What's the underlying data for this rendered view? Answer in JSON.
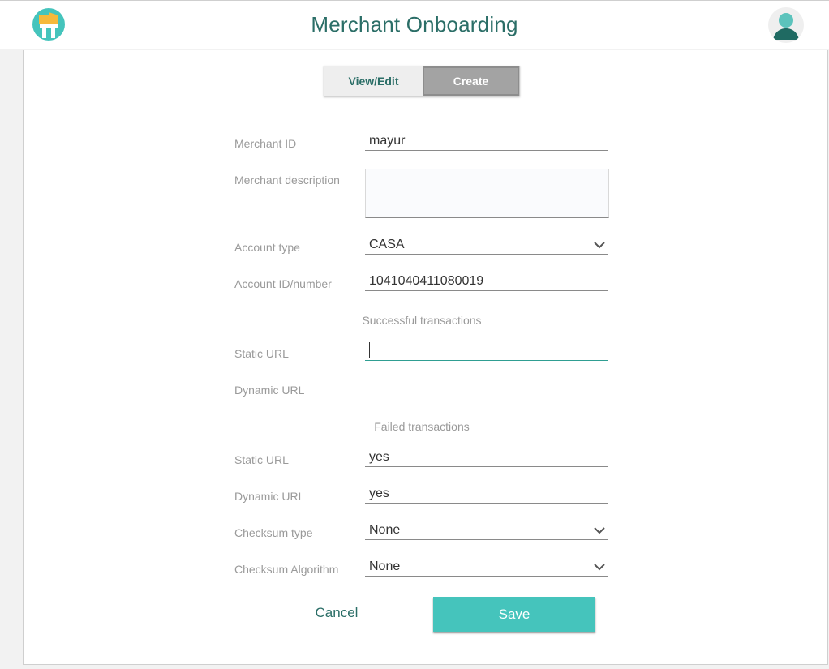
{
  "header": {
    "title": "Merchant Onboarding",
    "logo_icon": "app-logo-icon",
    "avatar_icon": "user-avatar-icon"
  },
  "tabs": [
    {
      "label": "View/Edit",
      "active": false
    },
    {
      "label": "Create",
      "active": true
    }
  ],
  "form": {
    "merchant_id": {
      "label": "Merchant ID",
      "value": "mayur"
    },
    "merchant_description": {
      "label": "Merchant description",
      "value": ""
    },
    "account_type": {
      "label": "Account type",
      "value": "CASA"
    },
    "account_id": {
      "label": "Account ID/number",
      "value": "1041040411080019"
    },
    "successful_section": "Successful transactions",
    "success_static_url": {
      "label": "Static URL",
      "value": ""
    },
    "success_dynamic_url": {
      "label": "Dynamic URL",
      "value": ""
    },
    "failed_section": "Failed transactions",
    "failed_static_url": {
      "label": "Static URL",
      "value": "yes"
    },
    "failed_dynamic_url": {
      "label": "Dynamic URL",
      "value": "yes"
    },
    "checksum_type": {
      "label": "Checksum type",
      "value": "None"
    },
    "checksum_algorithm": {
      "label": "Checksum Algorithm",
      "value": "None"
    }
  },
  "actions": {
    "cancel_label": "Cancel",
    "save_label": "Save"
  },
  "colors": {
    "accent": "#2b6e67",
    "save_button": "#45c4bc",
    "active_tab": "#a3a3a3"
  }
}
